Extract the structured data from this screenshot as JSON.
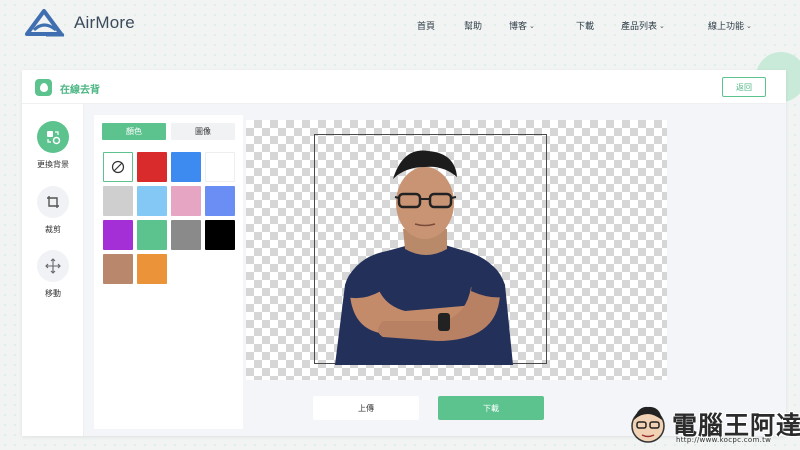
{
  "brand": {
    "name": "AirMore",
    "color": "#3f6fb0"
  },
  "nav": {
    "items": [
      {
        "label": "首頁",
        "dropdown": false
      },
      {
        "label": "幫助",
        "dropdown": false
      },
      {
        "label": "博客",
        "dropdown": true
      },
      {
        "label": "下載",
        "dropdown": false
      },
      {
        "label": "產品列表",
        "dropdown": true
      },
      {
        "label": "線上功能",
        "dropdown": true
      }
    ]
  },
  "tool": {
    "title": "在線去背",
    "back_label": "返回",
    "accent": "#5cc38f"
  },
  "sidebar": {
    "items": [
      {
        "label": "更換背景",
        "icon": "change-background-icon",
        "active": true
      },
      {
        "label": "裁剪",
        "icon": "crop-icon",
        "active": false
      },
      {
        "label": "移動",
        "icon": "move-icon",
        "active": false
      }
    ]
  },
  "panel": {
    "tabs": [
      {
        "label": "顏色",
        "active": true
      },
      {
        "label": "圖像",
        "active": false
      }
    ],
    "swatches": [
      "none",
      "#d92b2b",
      "#3d8bf0",
      "#ffffff",
      "#cfcfcf",
      "#84c9f5",
      "#e5a5c3",
      "#6b8ef5",
      "#a52fd6",
      "#5cc38f",
      "#8a8a8a",
      "#000000",
      "#b9876b",
      "#ea9338"
    ]
  },
  "actions": {
    "upload_label": "上傳",
    "download_label": "下載"
  },
  "watermark": {
    "text": "電腦王阿達",
    "url": "http://www.kocpc.com.tw"
  }
}
